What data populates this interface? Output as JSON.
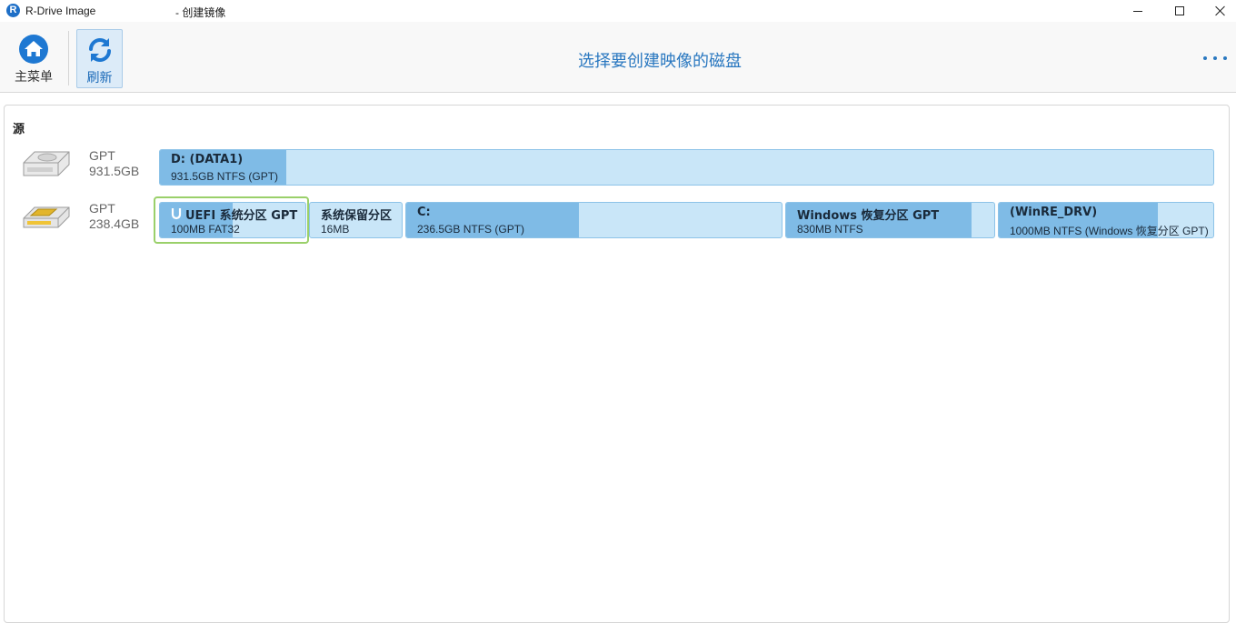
{
  "window": {
    "app_title": "R-Drive Image",
    "sub_title": "- 创建镜像",
    "logo_letter": "R"
  },
  "toolbar": {
    "home_label": "主菜单",
    "refresh_label": "刷新",
    "page_title": "选择要创建映像的磁盘"
  },
  "main": {
    "section_label": "源",
    "disks": [
      {
        "type": "GPT",
        "size": "931.5GB",
        "icon": "hdd-icon",
        "partitions": [
          {
            "name": "D: (DATA1)",
            "info": "931.5GB NTFS (GPT)",
            "used_fraction": 0.12
          }
        ]
      },
      {
        "type": "GPT",
        "size": "238.4GB",
        "icon": "ssd-icon",
        "partitions": [
          {
            "name": "UEFI 系统分区 GPT",
            "info": "100MB FAT32",
            "used_fraction": 0.5,
            "selected": true
          },
          {
            "name": "系统保留分区",
            "info": "16MB",
            "used_fraction": 0.0
          },
          {
            "name": "C:",
            "info": "236.5GB NTFS (GPT)",
            "used_fraction": 0.46
          },
          {
            "name": "Windows 恢复分区 GPT",
            "info": "830MB NTFS",
            "used_fraction": 0.89
          },
          {
            "name": "(WinRE_DRV)",
            "info": "1000MB NTFS (Windows 恢复分区 GPT)",
            "used_fraction": 0.74
          }
        ]
      }
    ]
  },
  "colors": {
    "accent": "#2a78c0",
    "partition_used": "#7fbbe6",
    "partition_free": "#c9e6f8",
    "selection": "#9ad06a"
  }
}
